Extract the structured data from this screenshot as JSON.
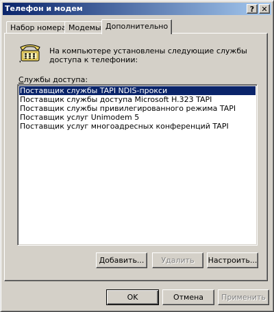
{
  "window": {
    "title": "Телефон и модем",
    "help_label": "?",
    "close_label": "✕"
  },
  "tabs": [
    {
      "label": "Набор номера",
      "active": false
    },
    {
      "label": "Модемы",
      "active": false
    },
    {
      "label": "Дополнительно",
      "active": true
    }
  ],
  "advanced": {
    "icon": "telephone-icon",
    "description": "На компьютере установлены следующие службы доступа к телефонии:",
    "list_label": "Службы доступа:",
    "providers": [
      "Поставщик службы TAPI NDIS-прокси",
      "Поставщик службы доступа Microsoft H.323 TAPI",
      "Поставщик службы привилегированного режима TAPI",
      "Поставщик услуг Unimodem 5",
      "Поставщик услуг многоадресных конференций TAPI"
    ],
    "selected_index": 0,
    "add_label": "Добавить...",
    "remove_label": "Удалить",
    "configure_label": "Настроить..."
  },
  "footer": {
    "ok_label": "OK",
    "cancel_label": "Отмена",
    "apply_label": "Применить"
  },
  "colors": {
    "face": "#d4d0c8",
    "title_start": "#0a246a",
    "title_end": "#a6caf0",
    "selection": "#0a246a"
  }
}
